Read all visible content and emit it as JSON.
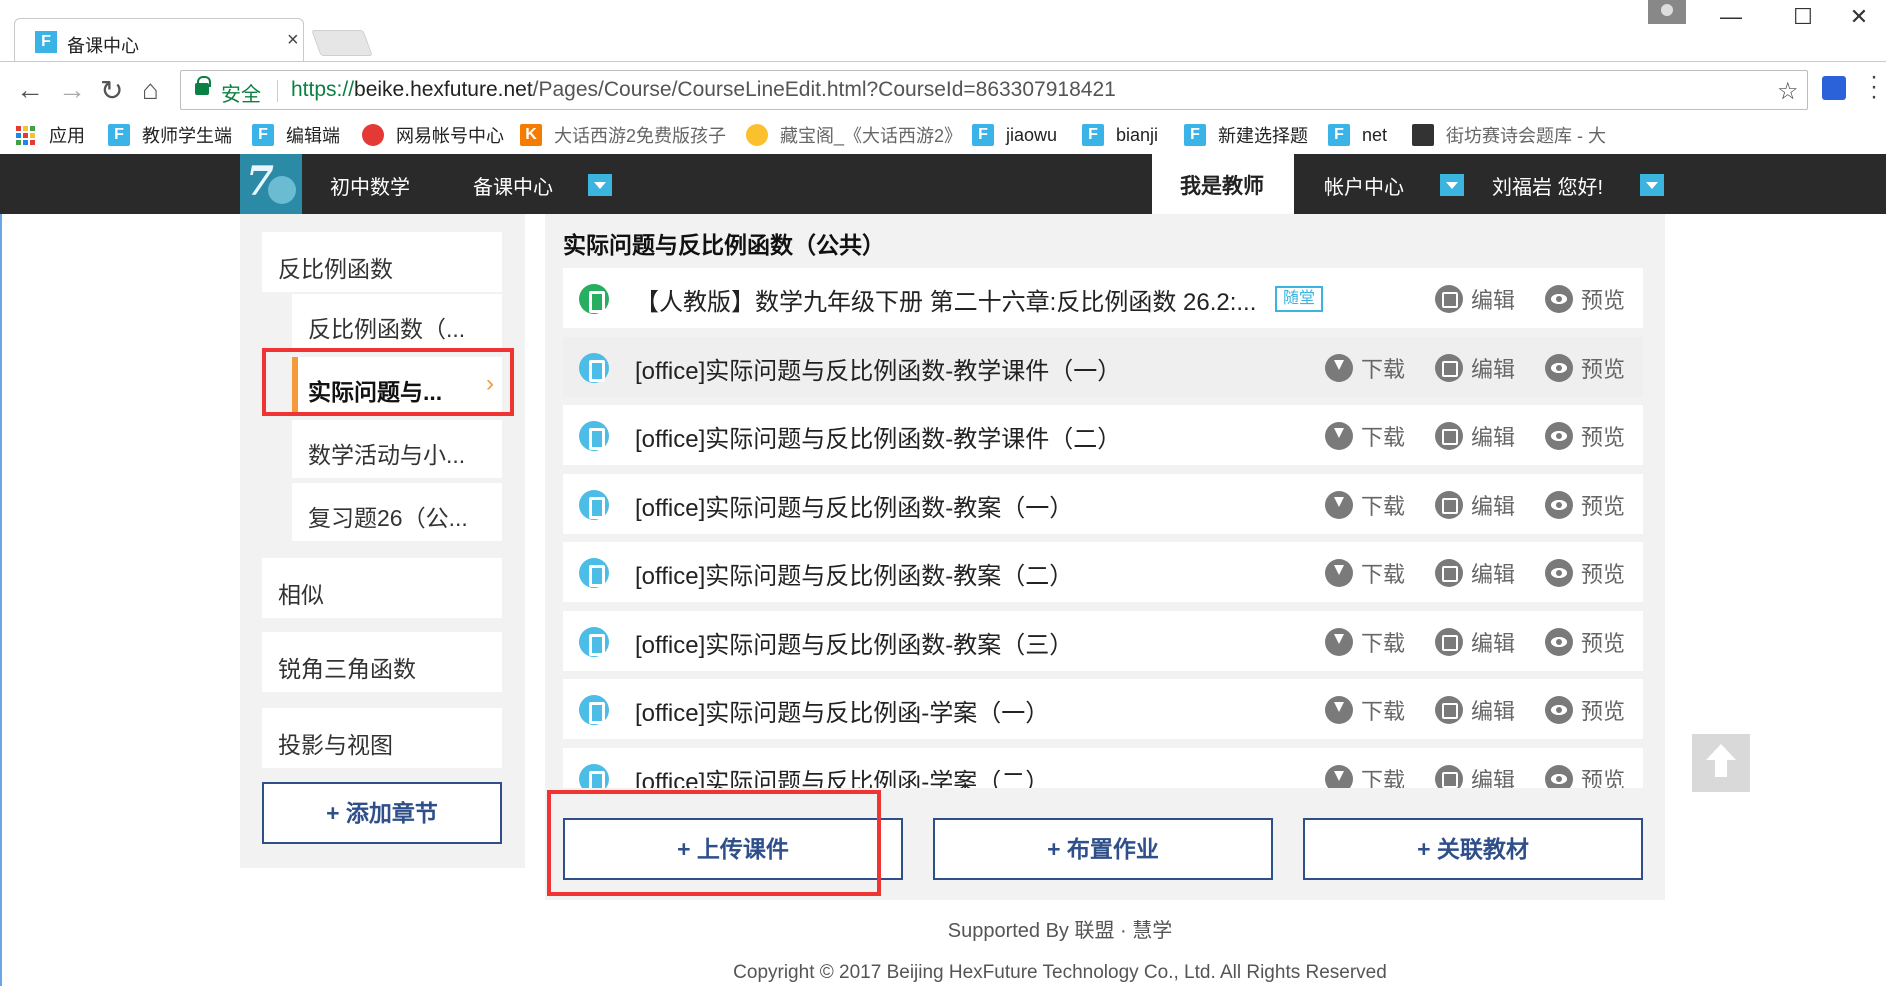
{
  "browser": {
    "tab_title": "备课中心",
    "tab_close": "×",
    "secure_label": "安全",
    "url_scheme": "https://",
    "url_host": "beike.hexfuture.net",
    "url_path": "/Pages/Course/CourseLineEdit.html?CourseId=863307918421",
    "window_controls": {
      "minimize": "—",
      "maximize": "☐",
      "close": "✕"
    },
    "nav_icons": [
      "back-icon",
      "forward-icon",
      "reload-icon",
      "home-icon"
    ],
    "bookmarks": [
      {
        "label": "应用",
        "icon": "apps-icon"
      },
      {
        "label": "教师学生端",
        "icon": "f-icon"
      },
      {
        "label": "编辑端",
        "icon": "f-icon"
      },
      {
        "label": "网易帐号中心",
        "icon": "netease-icon"
      },
      {
        "label": "大话西游2免费版孩子",
        "icon": "k-icon"
      },
      {
        "label": "藏宝阁_《大话西游2》",
        "icon": "treasure-icon"
      },
      {
        "label": "jiaowu",
        "icon": "f-icon"
      },
      {
        "label": "bianji",
        "icon": "f-icon"
      },
      {
        "label": "新建选择题",
        "icon": "f-icon"
      },
      {
        "label": "net",
        "icon": "f-icon"
      },
      {
        "label": "街坊赛诗会题库 - 大",
        "icon": "poem-icon"
      }
    ]
  },
  "header": {
    "nav": [
      "初中数学",
      "备课中心"
    ],
    "teacher_tab": "我是教师",
    "account": "帐户中心",
    "greeting": "刘福岩 您好!",
    "accent": "#3bb4e0"
  },
  "sidebar": {
    "chapters": [
      "反比例函数",
      "相似",
      "锐角三角函数",
      "投影与视图"
    ],
    "sub_items": [
      {
        "label": "反比例函数（...",
        "active": false
      },
      {
        "label": "实际问题与...",
        "active": true
      },
      {
        "label": "数学活动与小...",
        "active": false
      },
      {
        "label": "复习题26（公...",
        "active": false
      }
    ],
    "active_chevron": "›",
    "add_chapter": "+ 添加章节"
  },
  "main": {
    "course_title": "实际问题与反比例函数（公共）",
    "actions": {
      "download": "下载",
      "edit": "编辑",
      "preview": "预览"
    },
    "resources": [
      {
        "name": "【人教版】数学九年级下册 第二十六章:反比例函数 26.2:...",
        "badge": "随堂",
        "icon": "book-icon",
        "download": false
      },
      {
        "name": "[office]实际问题与反比例函数-教学课件（一）",
        "badge": "",
        "icon": "office-icon",
        "download": true
      },
      {
        "name": "[office]实际问题与反比例函数-教学课件（二）",
        "badge": "",
        "icon": "office-icon",
        "download": true
      },
      {
        "name": "[office]实际问题与反比例函数-教案（一）",
        "badge": "",
        "icon": "office-icon",
        "download": true
      },
      {
        "name": "[office]实际问题与反比例函数-教案（二）",
        "badge": "",
        "icon": "office-icon",
        "download": true
      },
      {
        "name": "[office]实际问题与反比例函数-教案（三）",
        "badge": "",
        "icon": "office-icon",
        "download": true
      },
      {
        "name": "[office]实际问题与反比例函-学案（一）",
        "badge": "",
        "icon": "office-icon",
        "download": true
      },
      {
        "name": "[office]实际问题与反比例函-学案（二）",
        "badge": "",
        "icon": "office-icon",
        "download": true
      }
    ],
    "buttons": {
      "upload": "+ 上传课件",
      "homework": "+ 布置作业",
      "textbook": "+ 关联教材"
    }
  },
  "footer": {
    "supported": "Supported By 联盟 · 慧学",
    "copyright": "Copyright © 2017 Beijing HexFuture Technology Co., Ltd. All Rights Reserved"
  }
}
